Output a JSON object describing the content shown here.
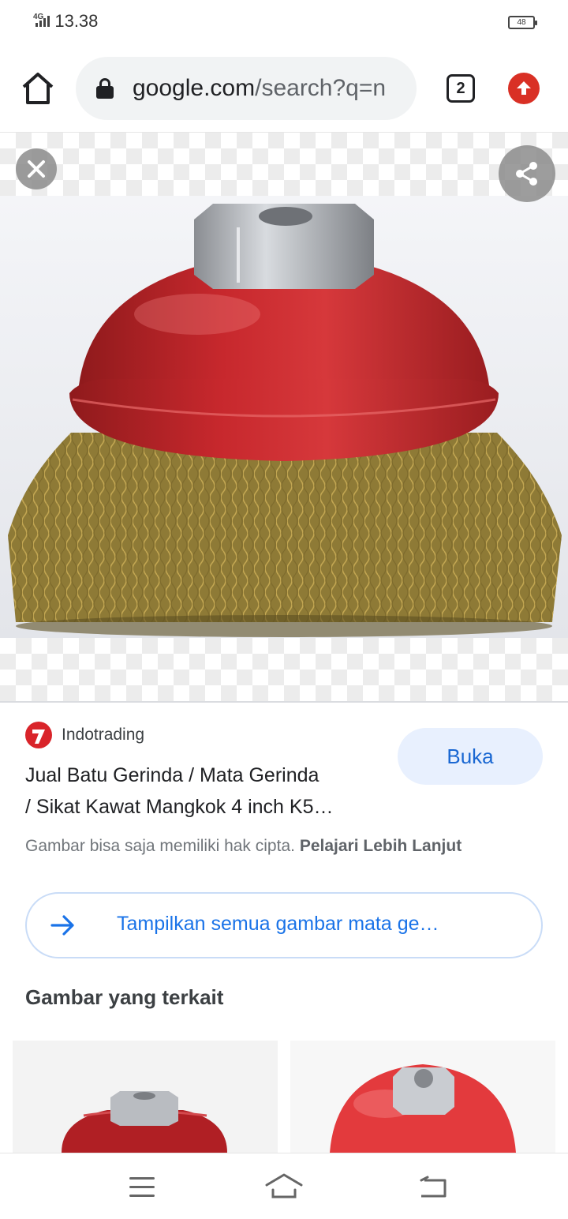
{
  "status_bar": {
    "network": "4G",
    "time": "13.38",
    "battery": "48"
  },
  "browser": {
    "url_domain": "google.com",
    "url_path": "/search?q=n",
    "tab_count": "2",
    "icons": [
      "home-icon",
      "lock-icon",
      "tab-switcher-icon",
      "update-icon"
    ]
  },
  "viewer": {
    "close_icon": "close-icon",
    "share_icon": "share-icon",
    "image_subject": "red cup wire brush with brass bristles and hex nut"
  },
  "result": {
    "source_name": "Indotrading",
    "title_line1": "Jual Batu Gerinda / Mata Gerinda",
    "title_line2": "/ Sikat Kawat Mangkok 4 inch K5…",
    "visit_label": "Buka",
    "copyright_text": "Gambar bisa saja memiliki hak cipta.",
    "learn_more_label": "Pelajari Lebih Lanjut"
  },
  "show_all": {
    "label": "Tampilkan semua gambar mata ge…"
  },
  "related": {
    "heading": "Gambar yang terkait"
  },
  "nav_bar": {
    "icons": [
      "menu-icon",
      "home-icon",
      "back-icon"
    ]
  },
  "colors": {
    "accent_blue": "#1a73e8",
    "button_bg": "#e8f0fe",
    "update_red": "#d93025",
    "brush_red": "#c0252b",
    "bristle_brass": "#a9903f"
  }
}
